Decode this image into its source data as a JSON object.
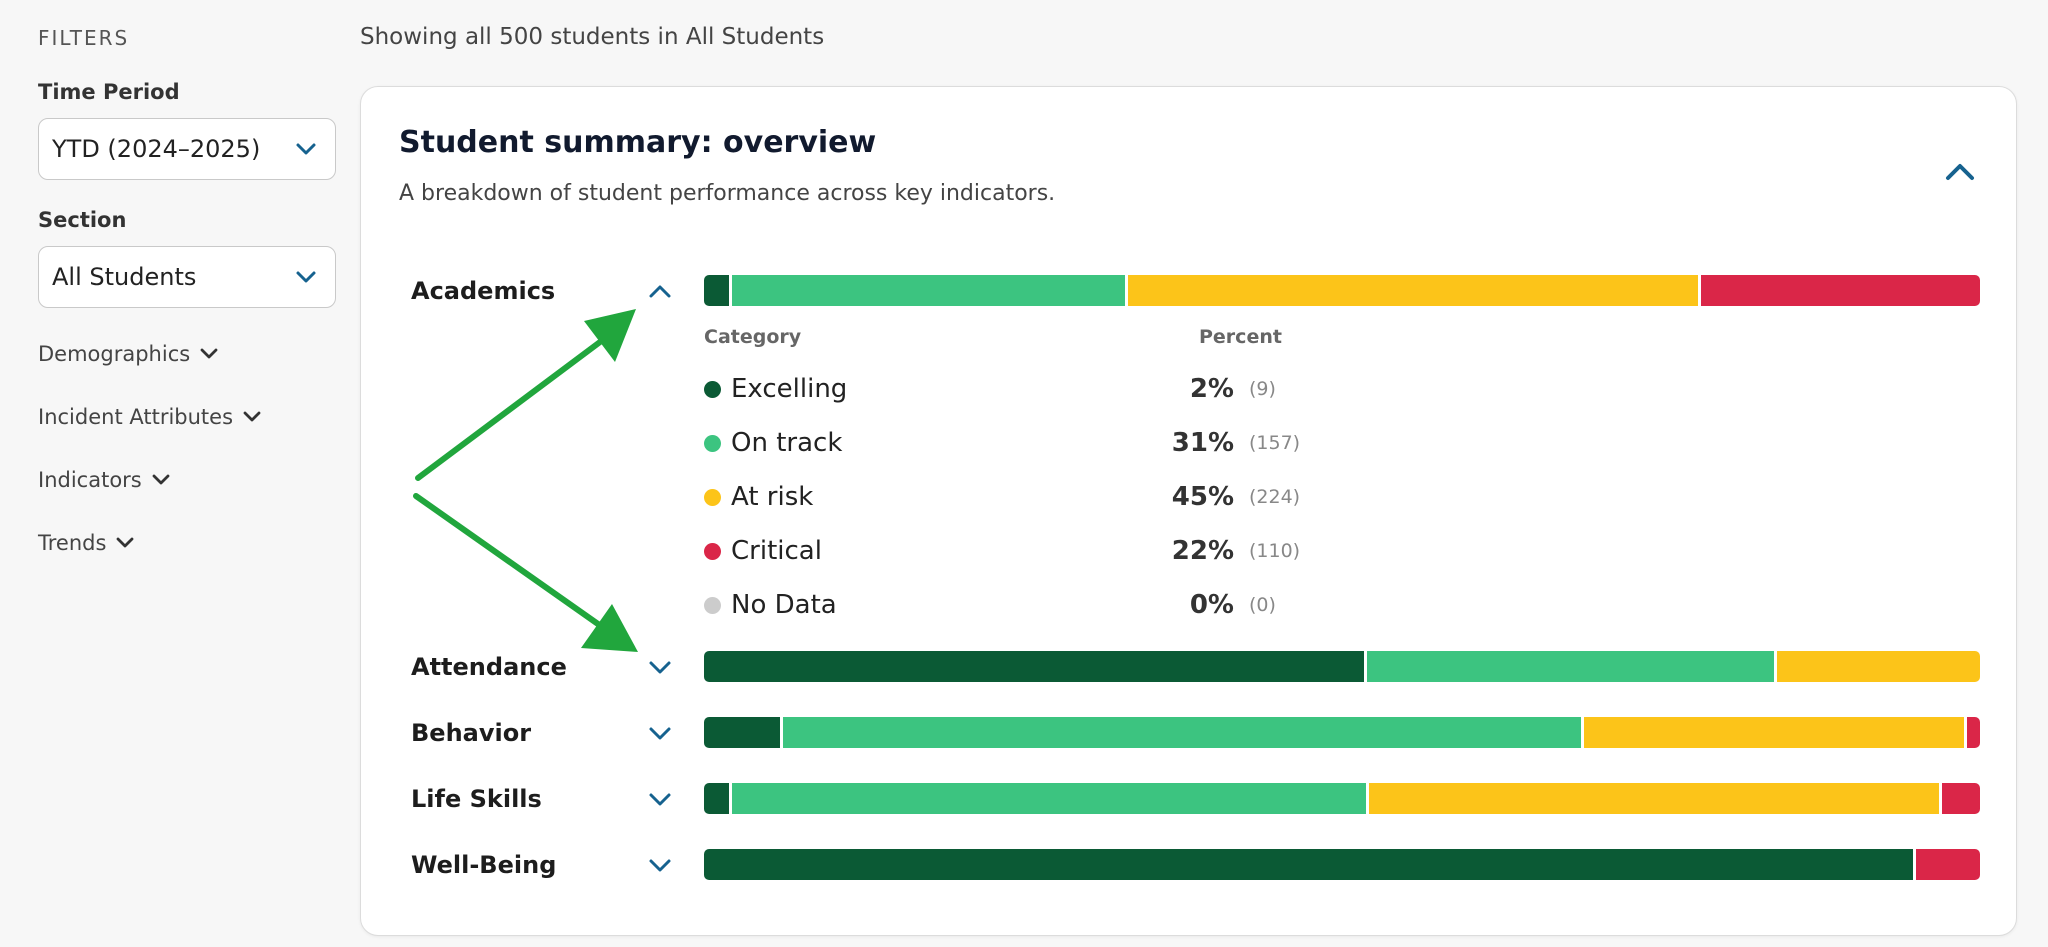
{
  "sidebar": {
    "title": "FILTERS",
    "time_period_label": "Time Period",
    "time_period_value": "YTD (2024–2025)",
    "section_label": "Section",
    "section_value": "All Students",
    "collapsers": [
      "Demographics",
      "Incident Attributes",
      "Indicators",
      "Trends"
    ]
  },
  "header": {
    "showing": "Showing all 500 students in All Students"
  },
  "card": {
    "title": "Student summary: overview",
    "subtitle": "A breakdown of student performance across key indicators."
  },
  "colors": {
    "excelling": "#0b5a35",
    "on_track": "#3cc480",
    "at_risk": "#fcc419",
    "critical": "#da2648",
    "no_data": "#cccccc",
    "accent": "#16628f",
    "arrow": "#21a63d"
  },
  "legend": {
    "category_header": "Category",
    "percent_header": "Percent",
    "items": [
      {
        "name": "Excelling",
        "percent": "2%",
        "count": "(9)",
        "color": "#0b5a35"
      },
      {
        "name": "On track",
        "percent": "31%",
        "count": "(157)",
        "color": "#3cc480"
      },
      {
        "name": "At risk",
        "percent": "45%",
        "count": "(224)",
        "color": "#fcc419"
      },
      {
        "name": "Critical",
        "percent": "22%",
        "count": "(110)",
        "color": "#da2648"
      },
      {
        "name": "No Data",
        "percent": "0%",
        "count": "(0)",
        "color": "#cccccc"
      }
    ]
  },
  "indicators": [
    {
      "label": "Academics",
      "expanded": true,
      "segments": [
        2,
        31,
        45,
        22
      ]
    },
    {
      "label": "Attendance",
      "expanded": false,
      "segments": [
        52,
        32,
        16,
        0
      ]
    },
    {
      "label": "Behavior",
      "expanded": false,
      "segments": [
        6,
        63,
        30,
        1
      ]
    },
    {
      "label": "Life Skills",
      "expanded": false,
      "segments": [
        2,
        50,
        45,
        3
      ]
    },
    {
      "label": "Well-Being",
      "expanded": false,
      "segments": [
        95,
        0,
        0,
        5
      ]
    }
  ]
}
